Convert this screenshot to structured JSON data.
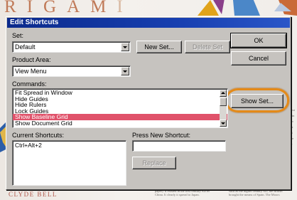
{
  "background": {
    "title_letters": [
      "R",
      "I",
      "G",
      "A",
      "M",
      "I"
    ],
    "author": "CLYDE BELL",
    "footer_text_left": "paper). It existed in the first century AD in China. It clearly it spread to Japan.",
    "footer_text_right": "such as the higher century AD, the British brought the means of Spain. The Moors",
    "side_text": [
      "agami",
      "per in",
      "ather",
      "sly a",
      "vent",
      "more",
      "aper"
    ]
  },
  "dialog": {
    "title": "Edit Shortcuts",
    "set_label": "Set:",
    "set_value": "Default",
    "new_set_label": "New Set...",
    "delete_set_label": "Delete Set",
    "product_area_label": "Product Area:",
    "product_area_value": "View Menu",
    "commands_label": "Commands:",
    "commands": [
      "Fit Spread in Window",
      "Hide Guides",
      "Hide Rulers",
      "Lock Guides",
      "Show Baseline Grid",
      "Show Document Grid"
    ],
    "selected_command": "Show Baseline Grid",
    "current_shortcuts_label": "Current Shortcuts:",
    "current_shortcuts": [
      "Ctrl+Alt+2"
    ],
    "press_new_shortcut_label": "Press New Shortcut:",
    "press_new_shortcut_value": "",
    "replace_label": "Replace",
    "ok_label": "OK",
    "cancel_label": "Cancel",
    "show_set_label": "Show Set...",
    "highlight_color": "#e48a18",
    "selection_color": "#e0526a",
    "titlebar_color": "#0b2a8c"
  }
}
